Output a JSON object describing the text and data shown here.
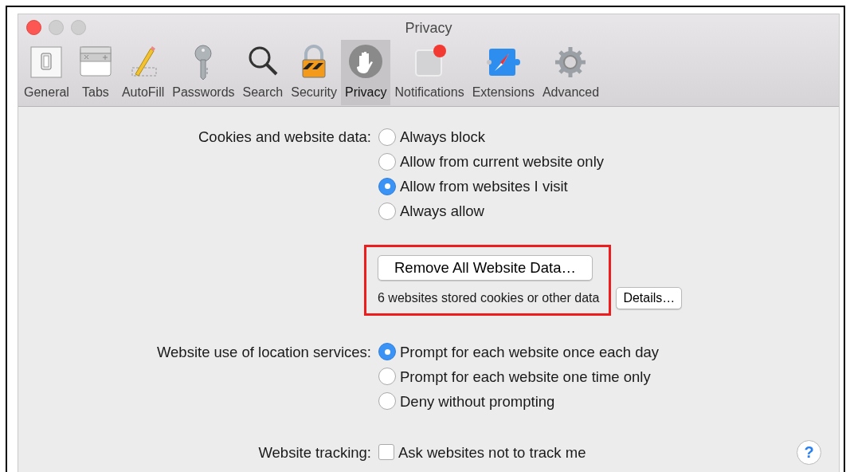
{
  "window": {
    "title": "Privacy"
  },
  "toolbar": [
    {
      "label": "General",
      "selected": false
    },
    {
      "label": "Tabs",
      "selected": false
    },
    {
      "label": "AutoFill",
      "selected": false
    },
    {
      "label": "Passwords",
      "selected": false
    },
    {
      "label": "Search",
      "selected": false
    },
    {
      "label": "Security",
      "selected": false
    },
    {
      "label": "Privacy",
      "selected": true
    },
    {
      "label": "Notifications",
      "selected": false
    },
    {
      "label": "Extensions",
      "selected": false
    },
    {
      "label": "Advanced",
      "selected": false
    }
  ],
  "settings": [
    {
      "kind": "radio",
      "label": "Cookies and website data:",
      "options": [
        {
          "label": "Always block",
          "selected": false
        },
        {
          "label": "Allow from current website only",
          "selected": false
        },
        {
          "label": "Allow from websites I visit",
          "selected": true
        },
        {
          "label": "Always allow",
          "selected": false
        }
      ]
    },
    {
      "kind": "data",
      "button": "Remove All Website Data…",
      "summary": "6 websites stored cookies or other data",
      "details_button": "Details…",
      "highlighted": true
    },
    {
      "kind": "radio",
      "label": "Website use of location services:",
      "options": [
        {
          "label": "Prompt for each website once each day",
          "selected": true
        },
        {
          "label": "Prompt for each website one time only",
          "selected": false
        },
        {
          "label": "Deny without prompting",
          "selected": false
        }
      ]
    },
    {
      "kind": "checkbox",
      "label": "Website tracking:",
      "option": "Ask websites not to track me",
      "checked": false
    }
  ],
  "help_button": "?"
}
